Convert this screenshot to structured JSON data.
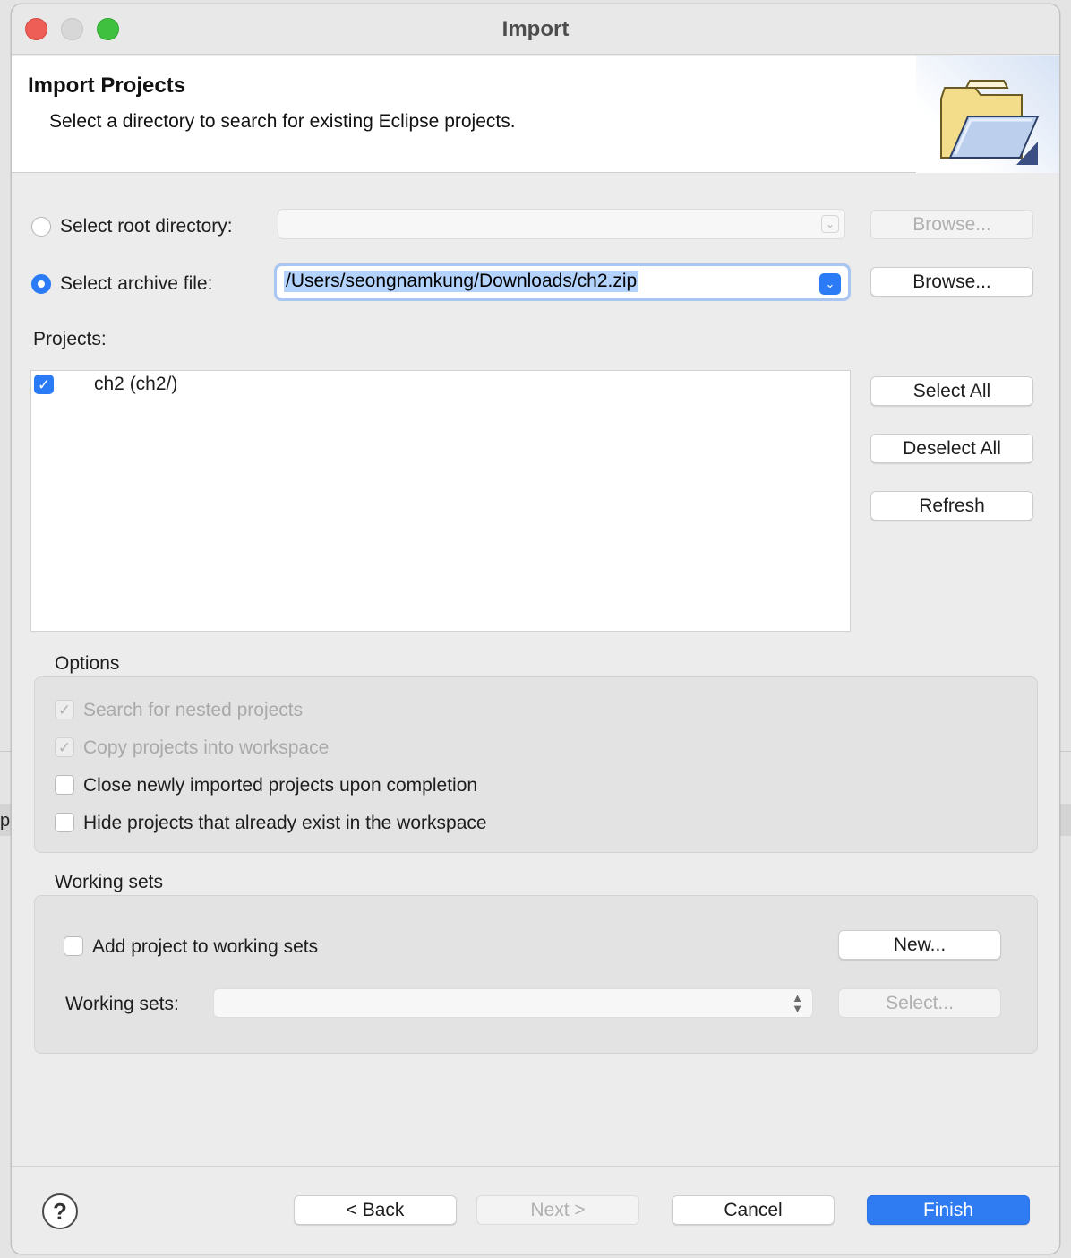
{
  "window": {
    "title": "Import"
  },
  "banner": {
    "title": "Import Projects",
    "description": "Select a directory to search for existing Eclipse projects.",
    "icon": "folder-open-icon"
  },
  "source": {
    "root_directory": {
      "label": "Select root directory:",
      "selected": false,
      "value": "",
      "browse_label": "Browse...",
      "enabled": false
    },
    "archive_file": {
      "label": "Select archive file:",
      "selected": true,
      "value": "/Users/seongnamkung/Downloads/ch2.zip",
      "browse_label": "Browse...",
      "enabled": true
    }
  },
  "projects": {
    "label": "Projects:",
    "items": [
      {
        "name": "ch2 (ch2/)",
        "checked": true
      }
    ],
    "select_all_label": "Select All",
    "deselect_all_label": "Deselect All",
    "refresh_label": "Refresh"
  },
  "options": {
    "title": "Options",
    "items": [
      {
        "label": "Search for nested projects",
        "checked": true,
        "enabled": false
      },
      {
        "label": "Copy projects into workspace",
        "checked": true,
        "enabled": false
      },
      {
        "label": "Close newly imported projects upon completion",
        "checked": false,
        "enabled": true
      },
      {
        "label": "Hide projects that already exist in the workspace",
        "checked": false,
        "enabled": true
      }
    ]
  },
  "working_sets": {
    "title": "Working sets",
    "add_label": "Add project to working sets",
    "add_checked": false,
    "new_label": "New...",
    "sets_label": "Working sets:",
    "sets_value": "",
    "select_label": "Select..."
  },
  "footer": {
    "back_label": "< Back",
    "next_label": "Next >",
    "cancel_label": "Cancel",
    "finish_label": "Finish",
    "help_symbol": "?"
  },
  "background": {
    "partial_text": "p"
  },
  "colors": {
    "accent": "#2f7bf2",
    "selection": "#b3d2fc",
    "close": "#ee5e56",
    "zoom": "#3fc13f"
  }
}
